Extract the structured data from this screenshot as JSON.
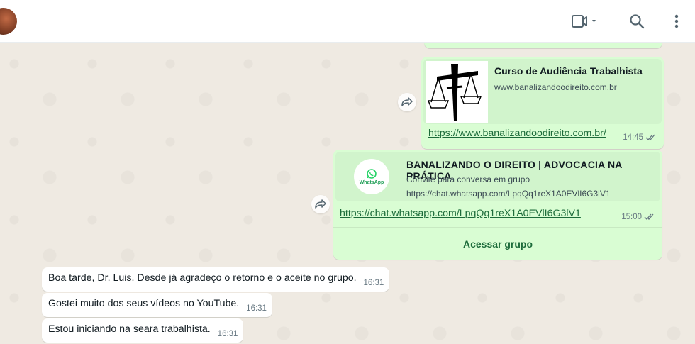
{
  "messages_out": {
    "link1": {
      "preview_title": "Curso de Audiência Trabalhista",
      "preview_domain": "www.banalizandoodireito.com.br",
      "url": "https://www.banalizandoodireito.com.br/",
      "time": "14:45"
    },
    "link2": {
      "preview_title": "BANALIZANDO O DIREITO | ADVOCACIA NA PRÁTICA",
      "preview_subtitle": "Convite para conversa em grupo",
      "preview_url": "https://chat.whatsapp.com/LpqQq1reX1A0EVlI6G3lV1",
      "url": "https://chat.whatsapp.com/LpqQq1reX1A0EVlI6G3lV1",
      "time": "15:00",
      "action_label": "Acessar grupo",
      "logo_label": "WhatsApp"
    }
  },
  "messages_in": [
    {
      "text": "Boa tarde, Dr. Luis. Desde já agradeço o retorno e o aceite no grupo.",
      "time": "16:31"
    },
    {
      "text": "Gostei muito dos seus vídeos no YouTube.",
      "time": "16:31"
    },
    {
      "text": "Estou iniciando na seara trabalhista.",
      "time": "16:31"
    }
  ],
  "colors": {
    "outgoing_bubble": "#d9fdd3",
    "incoming_bubble": "#ffffff",
    "chat_background": "#efeae2",
    "accent_green": "#1c6b3a"
  },
  "icons": [
    "video-call-icon",
    "search-icon",
    "menu-icon",
    "forward-icon",
    "double-check-icon",
    "whatsapp-logo-icon"
  ]
}
